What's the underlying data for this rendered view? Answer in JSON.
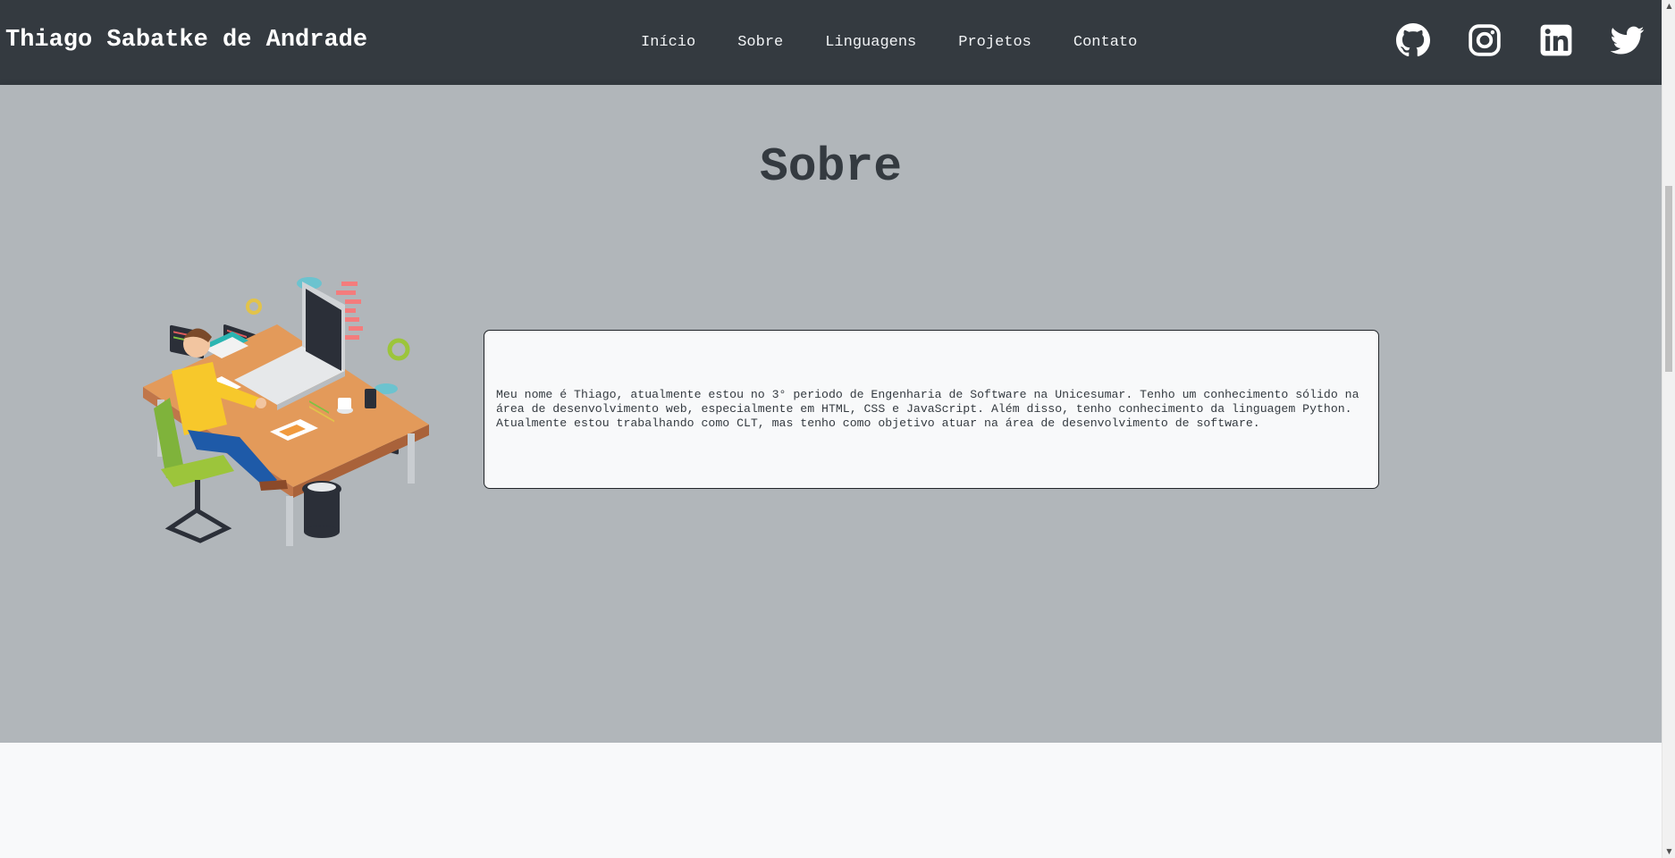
{
  "header": {
    "brand": "Thiago Sabatke de Andrade",
    "nav": [
      {
        "label": "Início"
      },
      {
        "label": "Sobre"
      },
      {
        "label": "Linguagens"
      },
      {
        "label": "Projetos"
      },
      {
        "label": "Contato"
      }
    ],
    "socials": [
      {
        "icon": "github-icon"
      },
      {
        "icon": "instagram-icon"
      },
      {
        "icon": "linkedin-icon"
      },
      {
        "icon": "twitter-icon"
      }
    ]
  },
  "about": {
    "title": "Sobre",
    "illustration_icon": "developer-desk-illustration",
    "text": "Meu nome é Thiago, atualmente estou no 3° periodo de Engenharia de Software na Unicesumar. Tenho um conhecimento sólido na área de desenvolvimento web, especialmente em HTML, CSS e JavaScript. Além disso, tenho conhecimento da linguagem Python. Atualmente estou trabalhando como CLT, mas tenho como objetivo atuar na área de desenvolvimento de software."
  },
  "colors": {
    "header_bg": "#343a40",
    "about_bg": "#b1b6ba",
    "page_bg": "#f8f9fa",
    "text_dark": "#343a40"
  }
}
